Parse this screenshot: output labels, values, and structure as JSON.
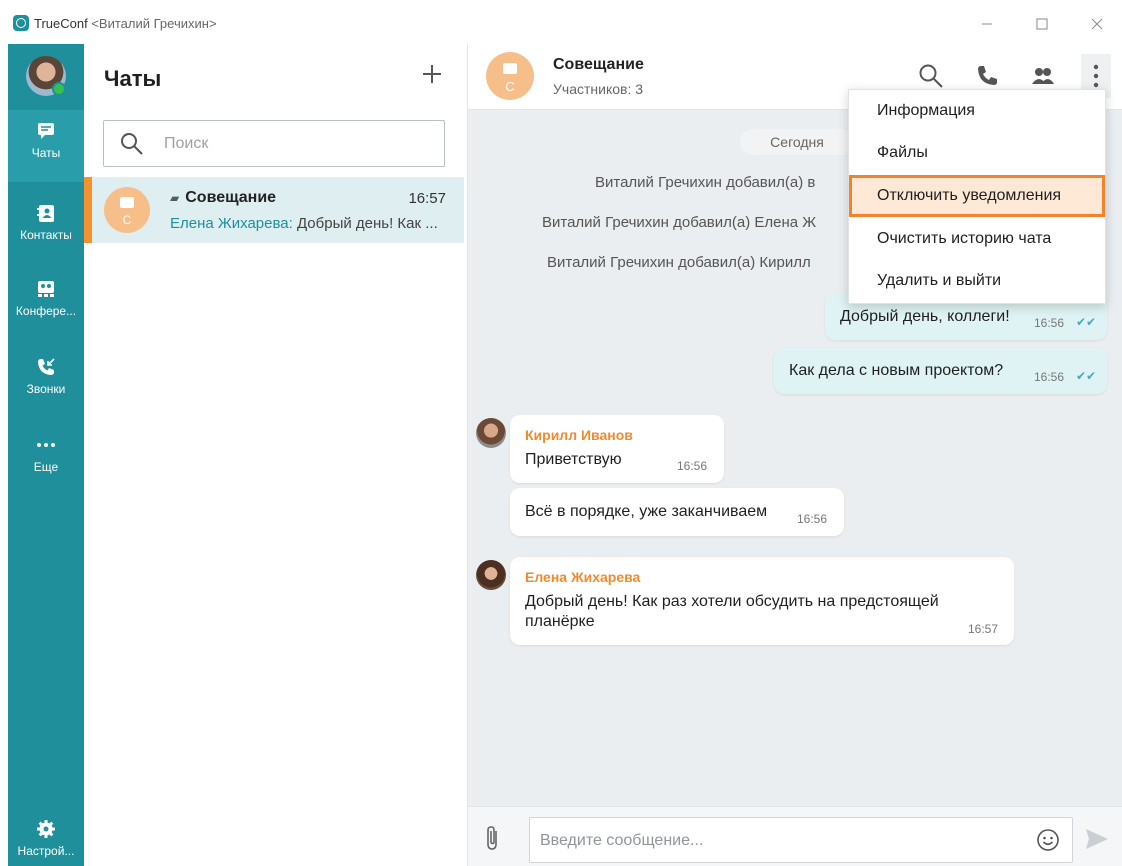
{
  "window": {
    "app_name": "TrueConf",
    "user_tag": "<Виталий Гречихин>",
    "controls": [
      "minimize",
      "maximize",
      "close"
    ]
  },
  "rail": {
    "items": [
      {
        "id": "chats",
        "label": "Чаты",
        "icon": "chat-icon",
        "active": true
      },
      {
        "id": "contacts",
        "label": "Контакты",
        "icon": "contacts-icon",
        "active": false
      },
      {
        "id": "conferences",
        "label": "Конфере...",
        "icon": "conference-icon",
        "active": false
      },
      {
        "id": "calls",
        "label": "Звонки",
        "icon": "calls-icon",
        "active": false
      },
      {
        "id": "more",
        "label": "Еще",
        "icon": "more-dots-icon",
        "active": false
      }
    ],
    "settings_label": "Настрой...",
    "accent": "#1f8f9c"
  },
  "chat_list": {
    "title": "Чаты",
    "search_placeholder": "Поиск",
    "chats": [
      {
        "name": "Совещание",
        "time": "16:57",
        "avatar_letter": "С",
        "preview_author": "Елена Жихарева:",
        "preview_text": " Добрый день! Как ..."
      }
    ]
  },
  "conversation": {
    "title": "Совещание",
    "subtitle": "Участников: 3",
    "avatar_letter": "С",
    "date_divider": "Сегодня",
    "system_messages": [
      "Виталий Гречихин добавил(а) в",
      "Виталий Гречихин добавил(а) Елена Ж",
      "Виталий Гречихин добавил(а) Кирилл"
    ],
    "outgoing": [
      {
        "text": "Добрый день, коллеги!",
        "time": "16:56"
      },
      {
        "text": "Как дела с новым проектом?",
        "time": "16:56"
      }
    ],
    "incoming": [
      {
        "sender": "Кирилл Иванов",
        "text": "Приветствую",
        "time": "16:56"
      },
      {
        "sender": "",
        "text": "Всё в порядке, уже заканчиваем",
        "time": "16:56"
      },
      {
        "sender": "Елена Жихарева",
        "text_line1": "Добрый день! Как раз хотели обсудить на предстоящей",
        "text_line2": "планёрке",
        "time": "16:57"
      }
    ],
    "composer_placeholder": "Введите сообщение..."
  },
  "menu": {
    "items": [
      {
        "label": "Информация",
        "highlighted": false
      },
      {
        "label": "Файлы",
        "highlighted": false
      },
      {
        "label": "Отключить уведомления",
        "highlighted": true
      },
      {
        "label": "Очистить историю чата",
        "highlighted": false
      },
      {
        "label": "Удалить и выйти",
        "highlighted": false
      }
    ]
  }
}
